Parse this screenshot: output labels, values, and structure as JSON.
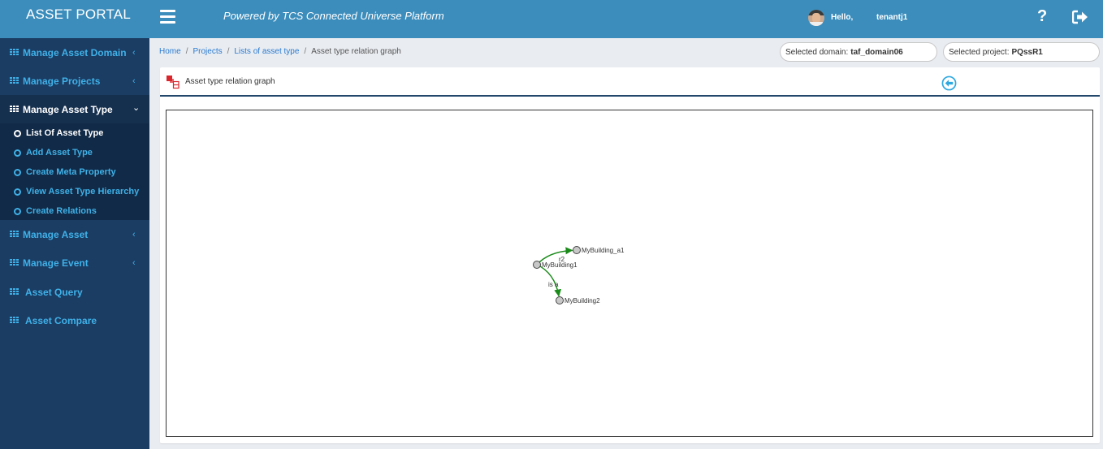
{
  "header": {
    "brand": "ASSET PORTAL",
    "powered_by": "Powered by TCS Connected Universe Platform",
    "greeting": "Hello,",
    "username": "tenantj1",
    "help_icon": "question-icon",
    "logout_icon": "sign-out-icon",
    "menu_icon": "hamburger-icon",
    "color": "#3c8dbc"
  },
  "sidebar": {
    "items": [
      {
        "label": "Manage Asset Domain",
        "icon": "grid-icon",
        "chevron": "‹"
      },
      {
        "label": "Manage Projects",
        "icon": "grid-icon",
        "chevron": "‹"
      },
      {
        "label": "Manage Asset Type",
        "icon": "grid-icon",
        "chevron": "⌄",
        "expanded": true
      },
      {
        "label": "Manage Asset",
        "icon": "grid-icon",
        "chevron": "‹"
      },
      {
        "label": "Manage Event",
        "icon": "grid-icon",
        "chevron": "‹"
      },
      {
        "label": "Asset Query",
        "icon": "grid-icon"
      },
      {
        "label": "Asset Compare",
        "icon": "grid-icon"
      }
    ],
    "submenu": [
      {
        "label": "List Of Asset Type",
        "current": true
      },
      {
        "label": "Add Asset Type"
      },
      {
        "label": "Create Meta Property"
      },
      {
        "label": "View Asset Type Hierarchy"
      },
      {
        "label": "Create Relations"
      }
    ],
    "color": "#1b3c63",
    "accent": "#3fb1e8"
  },
  "breadcrumb": {
    "items": [
      "Home",
      "Projects",
      "Lists of asset type"
    ],
    "current": "Asset type relation graph",
    "separator": "/"
  },
  "selectors": {
    "domain_label": "Selected domain:",
    "domain_value": "taf_domain06",
    "project_label": "Selected project:",
    "project_value": "PQssR1"
  },
  "panel": {
    "title": "Asset type relation graph",
    "back_icon": "arrow-circle-left-icon"
  },
  "graph": {
    "nodes": [
      {
        "id": "MyBuilding1",
        "label": "MyBuilding1"
      },
      {
        "id": "MyBuilding_a1",
        "label": "MyBuilding_a1"
      },
      {
        "id": "MyBuilding2",
        "label": "MyBuilding2"
      }
    ],
    "edges": [
      {
        "from": "MyBuilding1",
        "to": "MyBuilding_a1",
        "label": "r2"
      },
      {
        "from": "MyBuilding1",
        "to": "MyBuilding2",
        "label": "is a"
      }
    ],
    "edge_color": "#1a8a1a",
    "node_color": "#c8c8c8"
  }
}
